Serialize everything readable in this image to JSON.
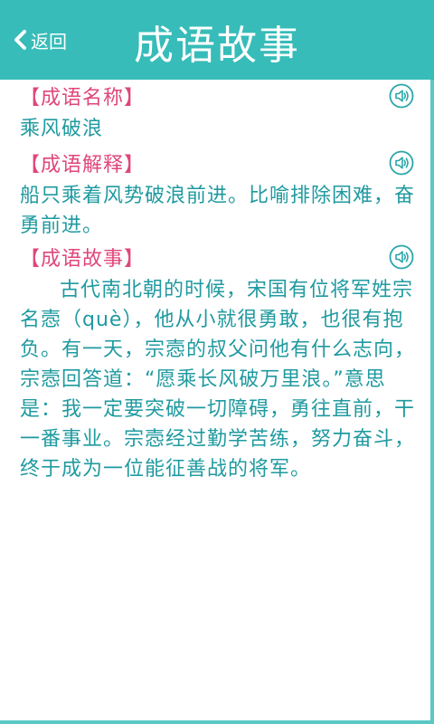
{
  "header": {
    "back_label": "返回",
    "title": "成语故事"
  },
  "sections": {
    "name": {
      "heading": "【成语名称】",
      "text": "乘风破浪"
    },
    "explanation": {
      "heading": "【成语解释】",
      "text": "船只乘着风势破浪前进。比喻排除困难，奋勇前进。"
    },
    "story": {
      "heading": "【成语故事】",
      "text": "古代南北朝的时候，宋国有位将军姓宗名悫（què），他从小就很勇敢，也很有抱负。有一天，宗悫的叔父问他有什么志向，宗悫回答道：“愿乘长风破万里浪。”意思是：我一定要突破一切障碍，勇往直前，干一番事业。宗悫经过勤学苦练，努力奋斗，终于成为一位能征善战的将军。"
    }
  },
  "colors": {
    "header": "#37bcb9",
    "heading_text": "#e0467a",
    "body_text": "#1f9aa0",
    "icon": "#2aa6a8"
  },
  "icons": {
    "back": "chevron-left-icon",
    "speaker": "speaker-icon"
  }
}
